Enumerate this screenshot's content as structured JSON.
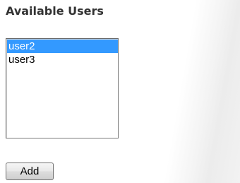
{
  "section": {
    "title": "Available Users"
  },
  "users_list": {
    "items": [
      {
        "label": "user2",
        "selected": true
      },
      {
        "label": "user3",
        "selected": false
      }
    ]
  },
  "actions": {
    "add_label": "Add"
  },
  "colors": {
    "selection_background": "#3399ff",
    "selection_text": "#ffffff",
    "heading_text": "#333333"
  }
}
